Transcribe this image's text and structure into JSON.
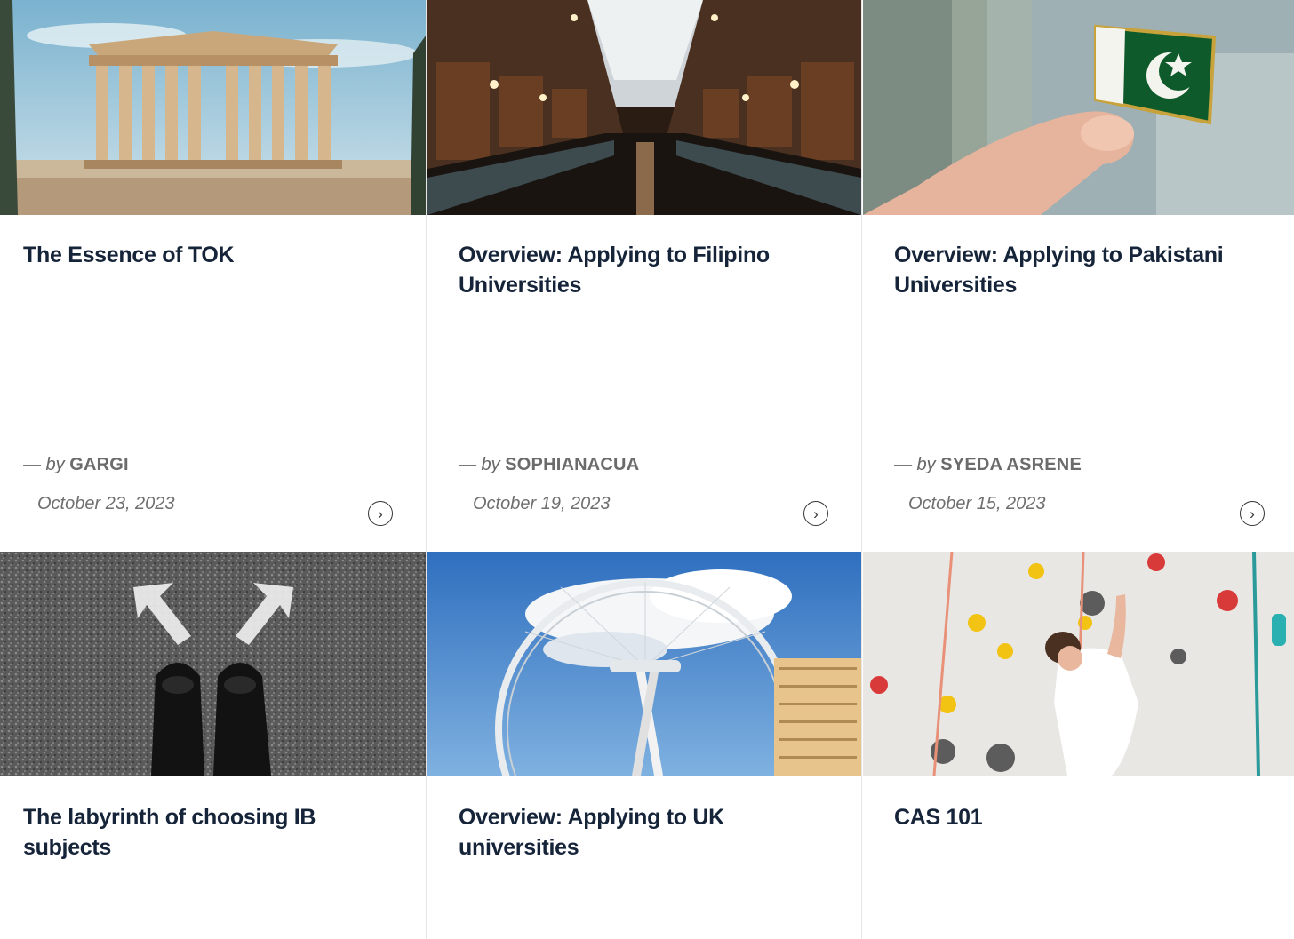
{
  "posts": [
    {
      "title": "The Essence of TOK",
      "by": "— by",
      "author": "GARGI",
      "date": "October 23, 2023",
      "image": "parthenon-photo"
    },
    {
      "title": "Overview: Applying to Filipino Universities",
      "by": "— by",
      "author": "SOPHIANACUA",
      "date": "October 19, 2023",
      "image": "library-photo"
    },
    {
      "title": "Overview: Applying to Pakistani Universities",
      "by": "— by",
      "author": "SYEDA ASRENE",
      "date": "October 15, 2023",
      "image": "pakistan-flag-pin-photo"
    },
    {
      "title": "The labyrinth of choosing IB subjects",
      "image": "arrows-and-shoes-photo"
    },
    {
      "title": "Overview: Applying to UK universities",
      "image": "london-eye-photo"
    },
    {
      "title": "CAS 101",
      "image": "climbing-wall-photo"
    }
  ],
  "icons": {
    "read_more": "chevron-right-circle-icon"
  },
  "colors": {
    "title": "#16243a",
    "meta": "#6b6b6b",
    "divider": "#e6e6e6"
  }
}
